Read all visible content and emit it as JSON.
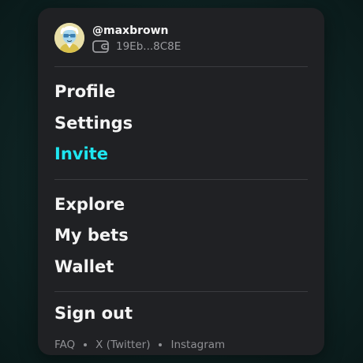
{
  "user": {
    "username": "@maxbrown",
    "wallet_address": "19Eb...8C8E",
    "avatar_icon": "cartoon-avatar",
    "wallet_icon": "wallet-icon"
  },
  "menu": {
    "account_items": [
      {
        "label": "Profile"
      },
      {
        "label": "Settings"
      },
      {
        "label": "Invite"
      }
    ],
    "nav_items": [
      {
        "label": "Explore"
      },
      {
        "label": "My bets"
      },
      {
        "label": "Wallet"
      }
    ],
    "sign_out_label": "Sign out"
  },
  "footer": {
    "links": [
      "FAQ",
      "X (Twitter)",
      "Instagram"
    ]
  },
  "colors": {
    "accent": "#1ee6f0",
    "card_background": "#202124",
    "text_primary": "#f4f4f4",
    "text_muted": "#8f9094"
  }
}
